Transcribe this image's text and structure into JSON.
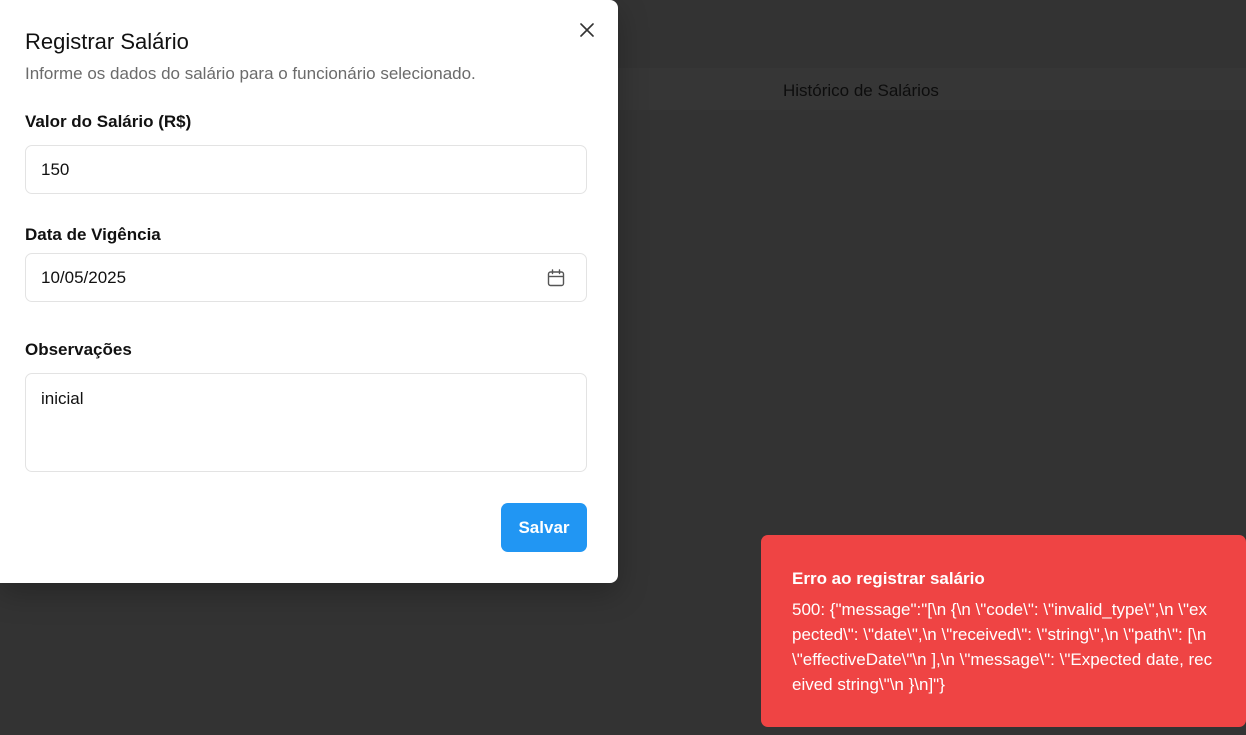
{
  "background": {
    "tab_title": "Histórico de Salários"
  },
  "dialog": {
    "title": "Registrar Salário",
    "description": "Informe os dados do salário para o funcionário selecionado.",
    "salary": {
      "label": "Valor do Salário (R$)",
      "value": "150"
    },
    "effective_date": {
      "label": "Data de Vigência",
      "value": "10/05/2025"
    },
    "notes": {
      "label": "Observações",
      "value": "inicial"
    },
    "save_label": "Salvar",
    "close_icon": "close-icon",
    "calendar_icon": "calendar-icon"
  },
  "toast": {
    "title": "Erro ao registrar salário",
    "message": "500: {\"message\":\"[\\n {\\n \\\"code\\\": \\\"invalid_type\\\",\\n \\\"expected\\\": \\\"date\\\",\\n \\\"received\\\": \\\"string\\\",\\n \\\"path\\\": [\\n \\\"effectiveDate\\\"\\n ],\\n \\\"message\\\": \\\"Expected date, received string\\\"\\n }\\n]\"}"
  },
  "colors": {
    "primary": "#2196f3",
    "error": "#ef4444",
    "overlay": "#333333"
  }
}
